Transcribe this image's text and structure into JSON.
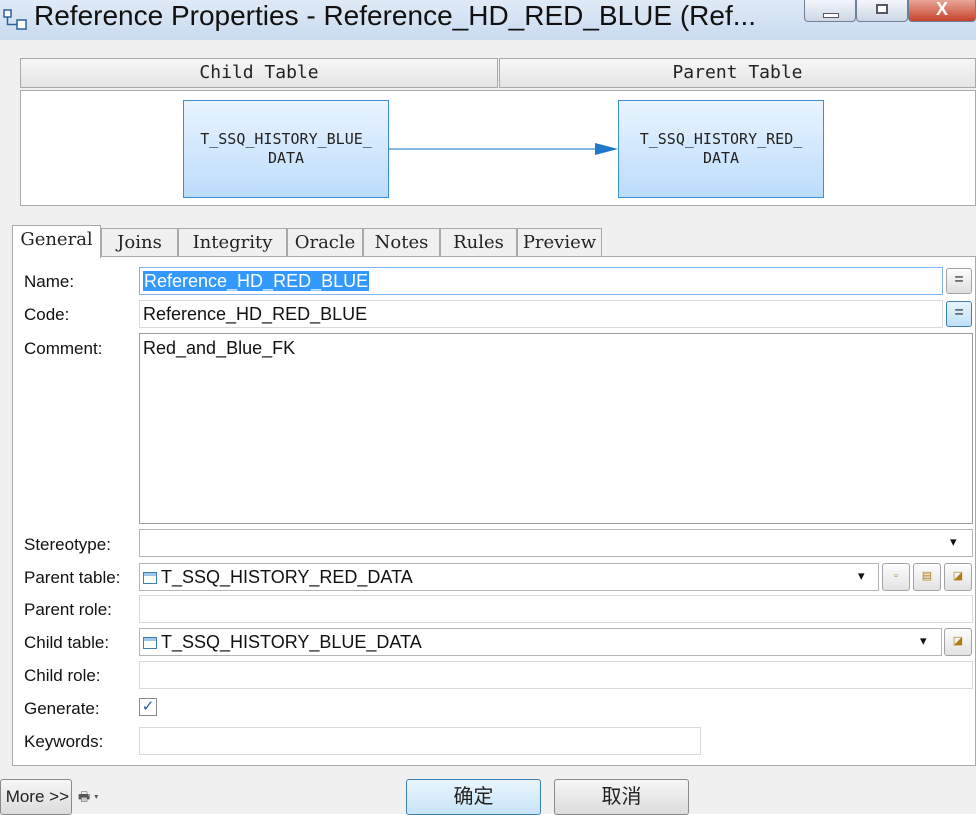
{
  "window": {
    "title": "Reference Properties - Reference_HD_RED_BLUE (Ref...",
    "close_glyph": "X"
  },
  "diagram": {
    "child_header": "Child Table",
    "parent_header": "Parent Table",
    "child_box": "T_SSQ_HISTORY_BLUE_\nDATA",
    "parent_box": "T_SSQ_HISTORY_RED_\nDATA"
  },
  "tabs": [
    {
      "label": "General",
      "active": true
    },
    {
      "label": "Joins"
    },
    {
      "label": "Integrity"
    },
    {
      "label": "Oracle"
    },
    {
      "label": "Notes"
    },
    {
      "label": "Rules"
    },
    {
      "label": "Preview"
    }
  ],
  "form": {
    "name_label": "Name:",
    "name_value": "Reference_HD_RED_BLUE",
    "code_label": "Code:",
    "code_value": "Reference_HD_RED_BLUE",
    "comment_label": "Comment:",
    "comment_value": "Red_and_Blue_FK",
    "stereotype_label": "Stereotype:",
    "stereotype_value": "",
    "parent_table_label": "Parent table:",
    "parent_table_value": "T_SSQ_HISTORY_RED_DATA",
    "parent_role_label": "Parent role:",
    "parent_role_value": "",
    "child_table_label": "Child table:",
    "child_table_value": "T_SSQ_HISTORY_BLUE_DATA",
    "child_role_label": "Child role:",
    "child_role_value": "",
    "generate_label": "Generate:",
    "generate_checked": true,
    "keywords_label": "Keywords:",
    "keywords_value": "",
    "equals_glyph": "=",
    "dropdown_glyph": "▾",
    "check_glyph": "✓"
  },
  "footer": {
    "more_label": "More >>",
    "ok_label": "确定",
    "cancel_label": "取消"
  },
  "colors": {
    "selection": "#3399ff",
    "box_border": "#3a8fd6",
    "box_fill": "#bcdcfb"
  }
}
